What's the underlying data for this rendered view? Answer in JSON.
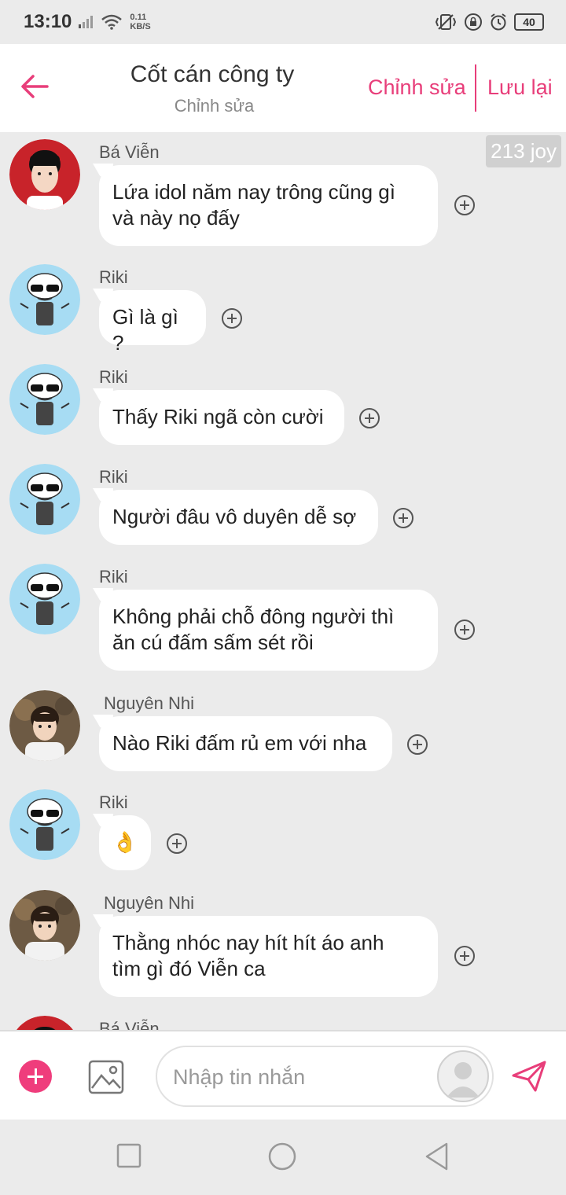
{
  "status_bar": {
    "time": "13:10",
    "speed_value": "0.11",
    "speed_unit": "KB/S",
    "battery": "40"
  },
  "header": {
    "title": "Cốt cán công ty",
    "subtitle": "Chỉnh sửa",
    "edit_label": "Chỉnh sửa",
    "save_label": "Lưu lại",
    "accent_color": "#e83e7a"
  },
  "messages": [
    {
      "sender": "Bá Viễn",
      "text_lines": [
        "Lứa idol năm nay trông cũng gì",
        "và này nọ đấy"
      ],
      "avatar": "red-background-boy"
    },
    {
      "sender": "Riki",
      "text_lines": [
        "Gì là gì ?"
      ],
      "avatar": "cartoon-sunglasses"
    },
    {
      "sender": "Riki",
      "text_lines": [
        "Thấy Riki ngã còn cười"
      ],
      "avatar": "cartoon-sunglasses"
    },
    {
      "sender": "Riki",
      "text_lines": [
        "Người đâu vô duyên dễ sợ"
      ],
      "avatar": "cartoon-sunglasses"
    },
    {
      "sender": "Riki",
      "text_lines": [
        "Không phải chỗ đông người thì",
        "ăn cú đấm sấm sét rồi"
      ],
      "avatar": "cartoon-sunglasses"
    },
    {
      "sender": "Nguyên Nhi",
      "text_lines": [
        "Nào Riki đấm rủ em với nha"
      ],
      "avatar": "boy-photo"
    },
    {
      "sender": "Riki",
      "text_lines": [
        "👌"
      ],
      "avatar": "cartoon-sunglasses"
    },
    {
      "sender": "Nguyên Nhi",
      "text_lines": [
        "Thằng nhóc nay hít hít áo anh",
        "tìm gì đó Viễn ca"
      ],
      "avatar": "boy-photo"
    },
    {
      "sender": "Bá Viễn",
      "text_lines": [],
      "avatar": "red-background-boy"
    }
  ],
  "joy_badge": "213 joy",
  "input": {
    "placeholder": "Nhập tin nhắn"
  }
}
